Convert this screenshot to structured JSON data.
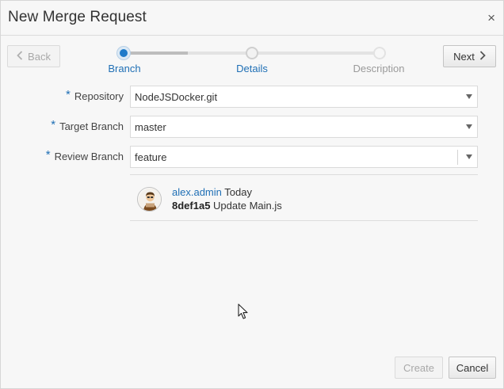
{
  "dialog": {
    "title": "New Merge Request",
    "close_glyph": "×"
  },
  "nav": {
    "back_label": "Back",
    "next_label": "Next"
  },
  "train": {
    "steps": [
      {
        "label": "Branch",
        "state": "active"
      },
      {
        "label": "Details",
        "state": "pending"
      },
      {
        "label": "Description",
        "state": "pending"
      }
    ]
  },
  "form": {
    "required_mark": "*",
    "repository": {
      "label": "Repository",
      "value": "NodeJSDocker.git"
    },
    "target_branch": {
      "label": "Target Branch",
      "value": "master"
    },
    "review_branch": {
      "label": "Review Branch",
      "value": "feature"
    }
  },
  "commit": {
    "author": "alex.admin",
    "when": "Today",
    "sha": "8def1a5",
    "message": "Update Main.js"
  },
  "footer": {
    "create_label": "Create",
    "cancel_label": "Cancel"
  },
  "icons": {
    "back": "chevron-left-icon",
    "next": "chevron-right-icon",
    "close": "close-icon",
    "dropdown": "caret-down-icon",
    "avatar": "user-avatar-icon",
    "pointer": "mouse-cursor-icon"
  },
  "colors": {
    "accent": "#1f7ac9",
    "link": "#1f6fb5",
    "muted": "#9a9a9a"
  }
}
